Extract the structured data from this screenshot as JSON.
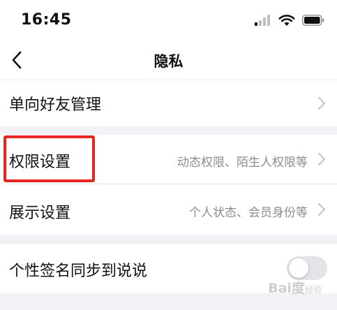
{
  "status_bar": {
    "time": "16:45",
    "icons": [
      "cellular-signal-icon",
      "wifi-icon",
      "battery-icon"
    ]
  },
  "nav": {
    "back_icon": "chevron-left-icon",
    "title": "隐私"
  },
  "rows": {
    "one_way_friends": {
      "label": "单向好友管理"
    },
    "permissions": {
      "label": "权限设置",
      "value": "动态权限、陌生人权限等"
    },
    "display": {
      "label": "展示设置",
      "value": "个人状态、会员身份等"
    },
    "signature_sync": {
      "label": "个性签名同步到说说",
      "toggle_on": false
    }
  },
  "watermark": {
    "text": "Bai度",
    "sub": "经验"
  },
  "colors": {
    "highlight": "#e8241c",
    "background": "#f2f2f6",
    "secondary_text": "#8c8c8c",
    "chevron": "#c4c4c8"
  }
}
